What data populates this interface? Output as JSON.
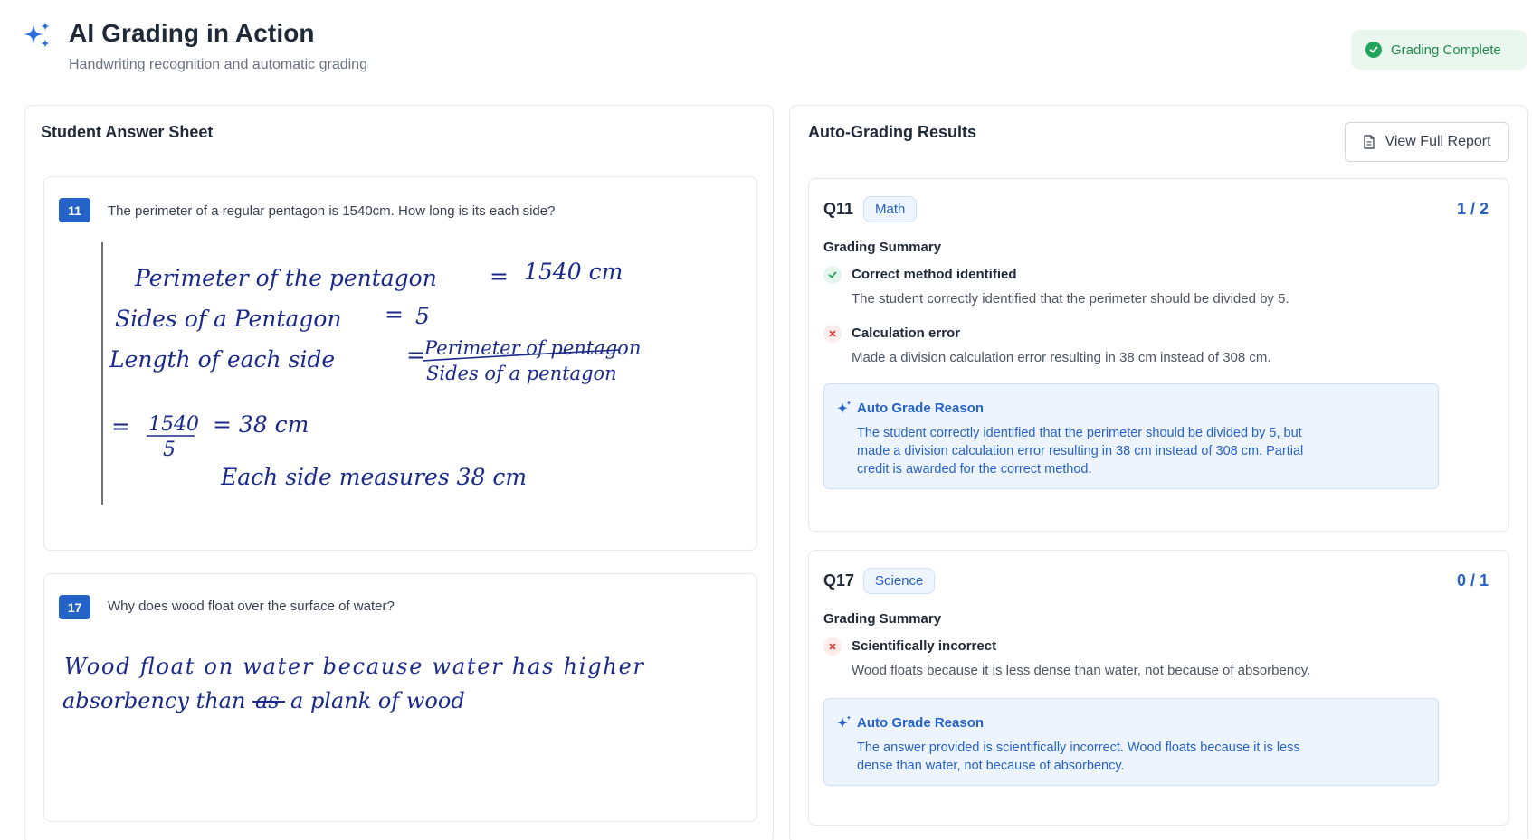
{
  "header": {
    "title": "AI Grading in Action",
    "subtitle": "Handwriting recognition and automatic grading",
    "status": "Grading Complete",
    "logo_icon": "sparkle-icon",
    "status_icon": "check-circle-icon"
  },
  "left_panel": {
    "title": "Student Answer Sheet",
    "questions": [
      {
        "number": "11",
        "text": "The perimeter of a regular pentagon is 1540cm. How long is its each side?",
        "handwriting": {
          "line1_a": "Perimeter of the pentagon",
          "line1_eq": "=",
          "line1_b": "1540 cm",
          "line2_a": "Sides of a Pentagon",
          "line2_eq": "=",
          "line2_b": "5",
          "line3_a": "Length of each side",
          "line3_eq": "=",
          "frac_num": "Perimeter of pentagon",
          "frac_den": "Sides of a pentagon",
          "calc_eq": "=",
          "calc_num": "1540",
          "calc_den": "5",
          "calc_res": "= 38 cm",
          "final": "Each side measures 38 cm"
        }
      },
      {
        "number": "17",
        "text": "Why does wood float over the surface of water?",
        "handwriting": {
          "line1": "Wood float on water because water has higher",
          "line2_a": "absorbency than",
          "line2_struck": "as",
          "line2_b": "a plank of wood"
        }
      }
    ]
  },
  "right_panel": {
    "title": "Auto-Grading Results",
    "view_report_label": "View Full Report",
    "view_report_icon": "document-icon",
    "summary_label": "Grading Summary",
    "reason_label": "Auto Grade Reason",
    "results": [
      {
        "qid": "Q11",
        "subject": "Math",
        "score": "1 / 2",
        "items": [
          {
            "status": "correct",
            "icon": "check-icon",
            "title": "Correct method identified",
            "desc": "The student correctly identified that the perimeter should be divided by 5."
          },
          {
            "status": "incorrect",
            "icon": "x-icon",
            "title": "Calculation error",
            "desc": "Made a division calculation error resulting in 38 cm instead of 308 cm."
          }
        ],
        "reason": "The student correctly identified that the perimeter should be divided by 5, but made a division calculation error resulting in 38 cm instead of 308 cm. Partial credit is awarded for the correct method."
      },
      {
        "qid": "Q17",
        "subject": "Science",
        "score": "0 / 1",
        "items": [
          {
            "status": "incorrect",
            "icon": "x-icon",
            "title": "Scientifically incorrect",
            "desc": "Wood floats because it is less dense than water, not because of absorbency."
          }
        ],
        "reason": "The answer provided is scientifically incorrect. Wood floats because it is less dense than water, not because of absorbency."
      }
    ]
  },
  "colors": {
    "accent": "#2563c9",
    "success": "#22a55a",
    "error": "#e53935",
    "ink": "#1a2a8c"
  }
}
